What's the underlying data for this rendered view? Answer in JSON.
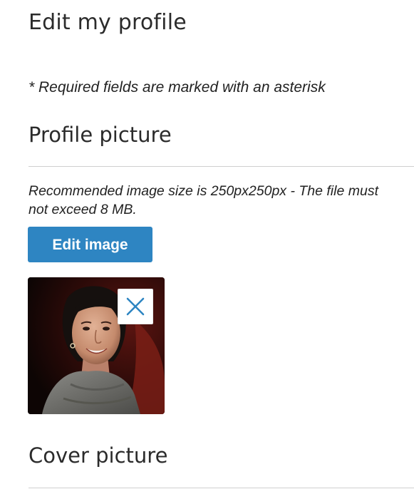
{
  "page": {
    "title": "Edit my profile",
    "required_note": "* Required fields are marked with an asterisk"
  },
  "profile_picture": {
    "heading": "Profile picture",
    "hint": "Recommended image size is 250px250px - The file must not exceed 8 MB.",
    "edit_button_label": "Edit image",
    "remove_icon": "close-icon"
  },
  "cover_picture": {
    "heading": "Cover picture"
  },
  "colors": {
    "accent": "#2e85c2",
    "text": "#2b2b2b",
    "divider": "#cfcfcf",
    "remove_icon": "#2e85c2"
  }
}
